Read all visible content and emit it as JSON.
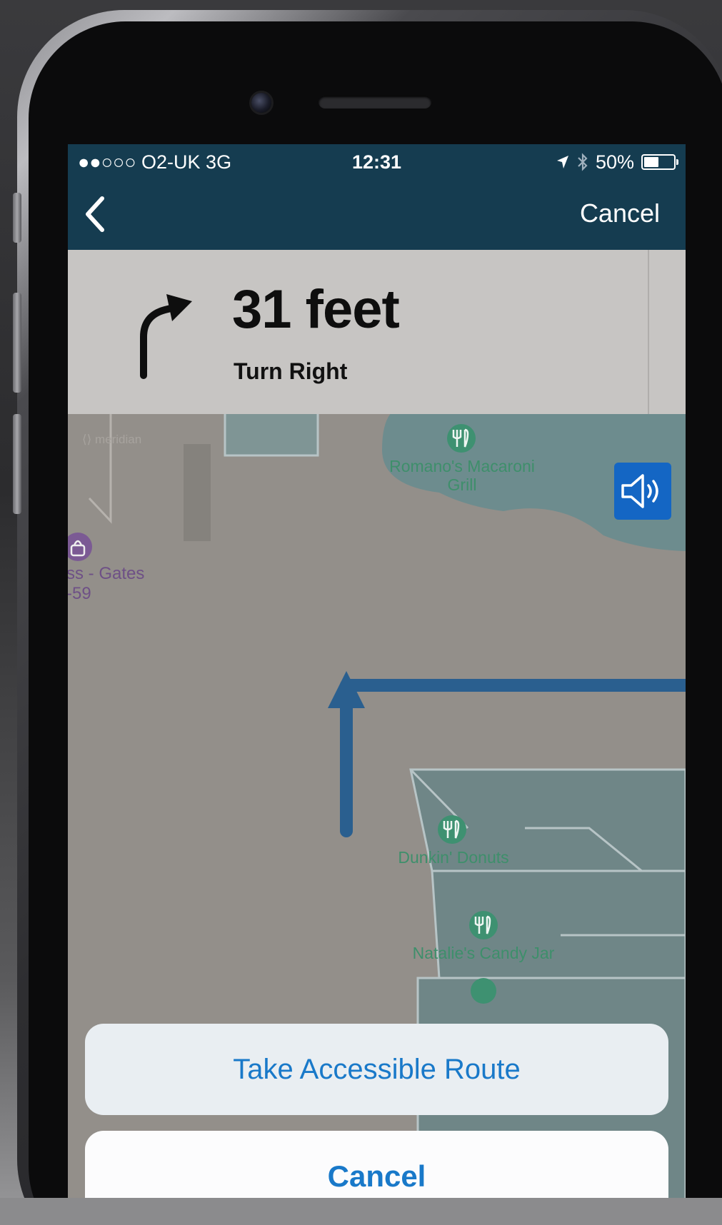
{
  "status_bar": {
    "carrier": "●●○○○ O2-UK  3G",
    "time": "12:31",
    "battery": "50%"
  },
  "nav": {
    "cancel_label": "Cancel"
  },
  "instruction": {
    "distance": "31 feet",
    "maneuver": "Turn Right"
  },
  "map": {
    "attribution": "meridian",
    "places": [
      {
        "name": "Romano's Macaroni",
        "name2": "Grill"
      },
      {
        "name": "Dunkin' Donuts"
      },
      {
        "name": "Natalie's Candy Jar"
      }
    ],
    "partial_label_line1": "ss - Gates",
    "partial_label_line2": "-59"
  },
  "action_sheet": {
    "primary_label": "Take Accessible Route",
    "cancel_label": "Cancel"
  },
  "colors": {
    "header": "#153c50",
    "route": "#2a5f8f",
    "accent": "#1979c9",
    "poi_green": "#3e9171",
    "sound_button": "#1466c4"
  }
}
